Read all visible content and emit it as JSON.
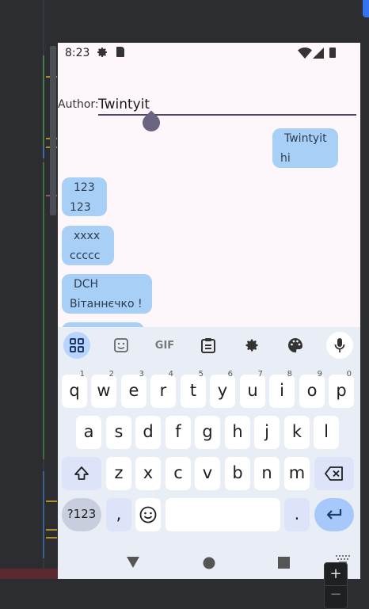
{
  "status_bar": {
    "time": "8:23"
  },
  "author": {
    "label": "Author:",
    "value": "Twintyit"
  },
  "messages": [
    {
      "author": "Twintyit",
      "text": "hi",
      "side": "right"
    },
    {
      "author": "123",
      "text": "123",
      "side": "left"
    },
    {
      "author": "xxxx",
      "text": "ccccc",
      "side": "left"
    },
    {
      "author": "DCH",
      "text": "Вітаннєчко !",
      "side": "left"
    }
  ],
  "keyboard": {
    "toolbar": [
      "apps-icon",
      "sticker-icon",
      "gif-icon",
      "clipboard-icon",
      "settings-icon",
      "palette-icon",
      "microphone-icon"
    ],
    "gif_label": "GIF",
    "row1": [
      {
        "k": "q",
        "h": "1"
      },
      {
        "k": "w",
        "h": "2"
      },
      {
        "k": "e",
        "h": "3"
      },
      {
        "k": "r",
        "h": "4"
      },
      {
        "k": "t",
        "h": "5"
      },
      {
        "k": "y",
        "h": "6"
      },
      {
        "k": "u",
        "h": "7"
      },
      {
        "k": "i",
        "h": "8"
      },
      {
        "k": "o",
        "h": "9"
      },
      {
        "k": "p",
        "h": "0"
      }
    ],
    "row2": [
      "a",
      "s",
      "d",
      "f",
      "g",
      "h",
      "j",
      "k",
      "l"
    ],
    "row3": [
      "z",
      "x",
      "c",
      "v",
      "b",
      "n",
      "m"
    ],
    "symbols_label": "?123",
    "comma": ",",
    "period": "."
  },
  "zoom": {
    "plus": "+",
    "minus": "−"
  },
  "colors": {
    "bubble": "#a8cff5",
    "keyboard_bg": "#e9eef6",
    "enter": "#a6c8fa",
    "accent": "#3574f0"
  }
}
